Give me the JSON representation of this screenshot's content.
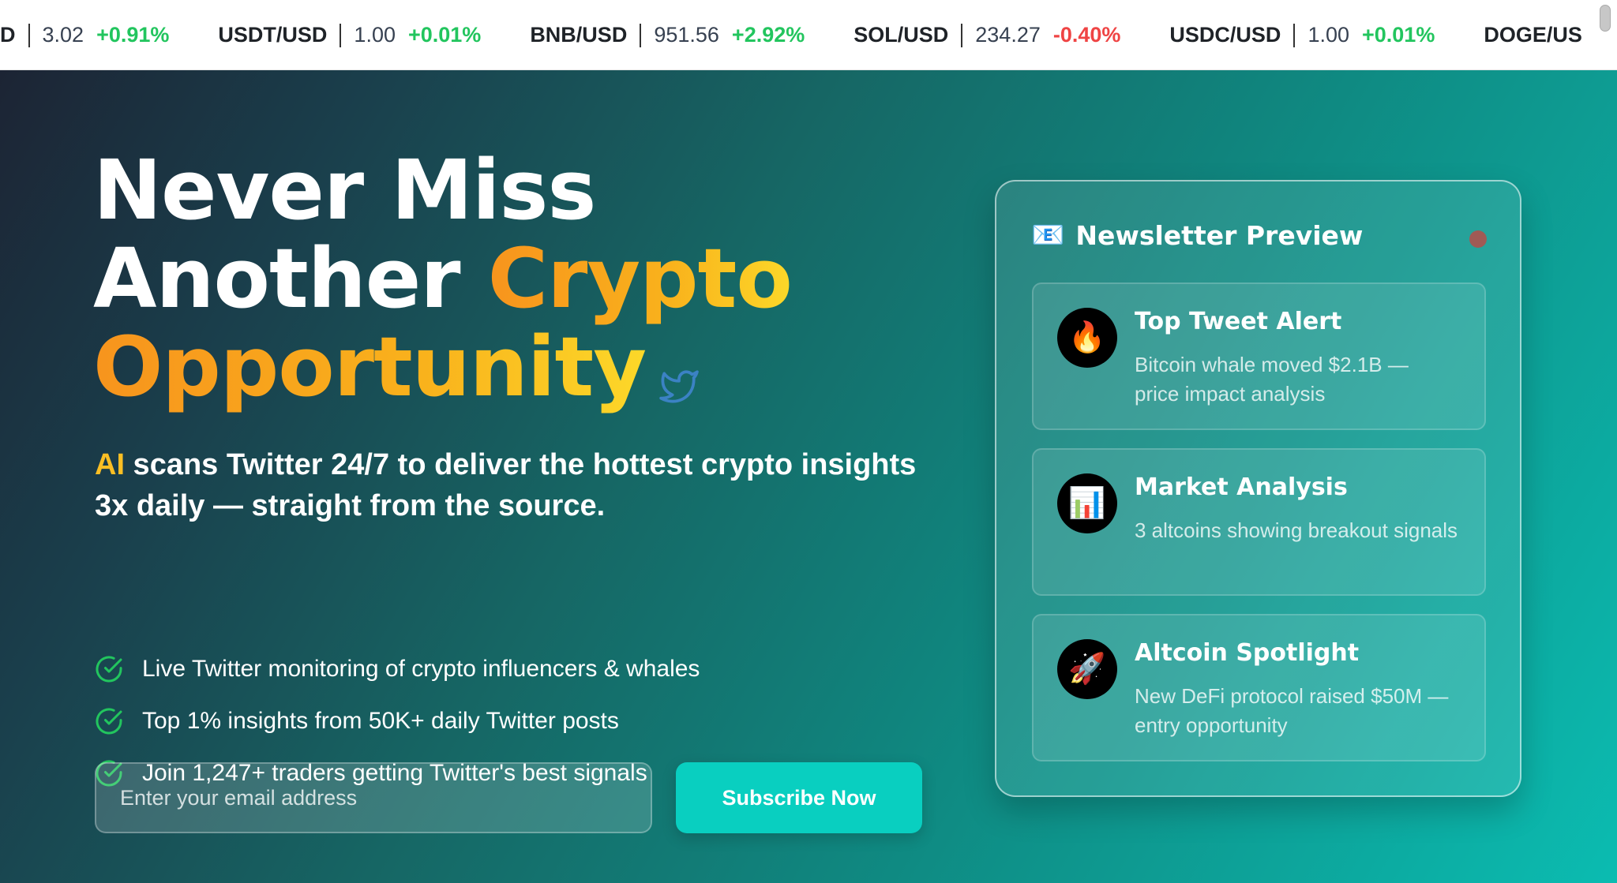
{
  "ticker": [
    {
      "pair": "SD",
      "price": "3.02",
      "change": "+0.91%",
      "direction": "up"
    },
    {
      "pair": "USDT/USD",
      "price": "1.00",
      "change": "+0.01%",
      "direction": "up"
    },
    {
      "pair": "BNB/USD",
      "price": "951.56",
      "change": "+2.92%",
      "direction": "up"
    },
    {
      "pair": "SOL/USD",
      "price": "234.27",
      "change": "-0.40%",
      "direction": "down"
    },
    {
      "pair": "USDC/USD",
      "price": "1.00",
      "change": "+0.01%",
      "direction": "up"
    },
    {
      "pair": "DOGE/US",
      "price": "",
      "change": "",
      "direction": "up"
    }
  ],
  "hero": {
    "headline_line1": "Never Miss",
    "headline_line2_plain": "Another ",
    "headline_line2_accent": "Crypto",
    "headline_line3_accent": "Opportunity",
    "headline_icon": "twitter-bird-icon",
    "subtitle_ai": "AI",
    "subtitle_rest": " scans Twitter 24/7 to deliver the hottest crypto insights 3x daily — straight from the source.",
    "features": [
      "Live Twitter monitoring of crypto influencers & whales",
      "Top 1% insights from 50K+ daily Twitter posts",
      "Join 1,247+ traders getting Twitter's best signals"
    ],
    "email_placeholder": "Enter your email address",
    "subscribe_label": "Subscribe Now"
  },
  "preview": {
    "icon": "📧",
    "title": "Newsletter Preview",
    "items": [
      {
        "icon": "🔥",
        "title": "Top Tweet Alert",
        "desc": "Bitcoin whale moved $2.1B — price impact analysis"
      },
      {
        "icon": "📊",
        "title": "Market Analysis",
        "desc": "3 altcoins showing breakout signals"
      },
      {
        "icon": "🚀",
        "title": "Altcoin Spotlight",
        "desc": "New DeFi protocol raised $50M — entry opportunity"
      }
    ]
  },
  "colors": {
    "accent_orange": "#f7941d",
    "accent_yellow": "#fcd829",
    "positive": "#22c55e",
    "negative": "#ef4444",
    "button": "#09cfc0"
  }
}
